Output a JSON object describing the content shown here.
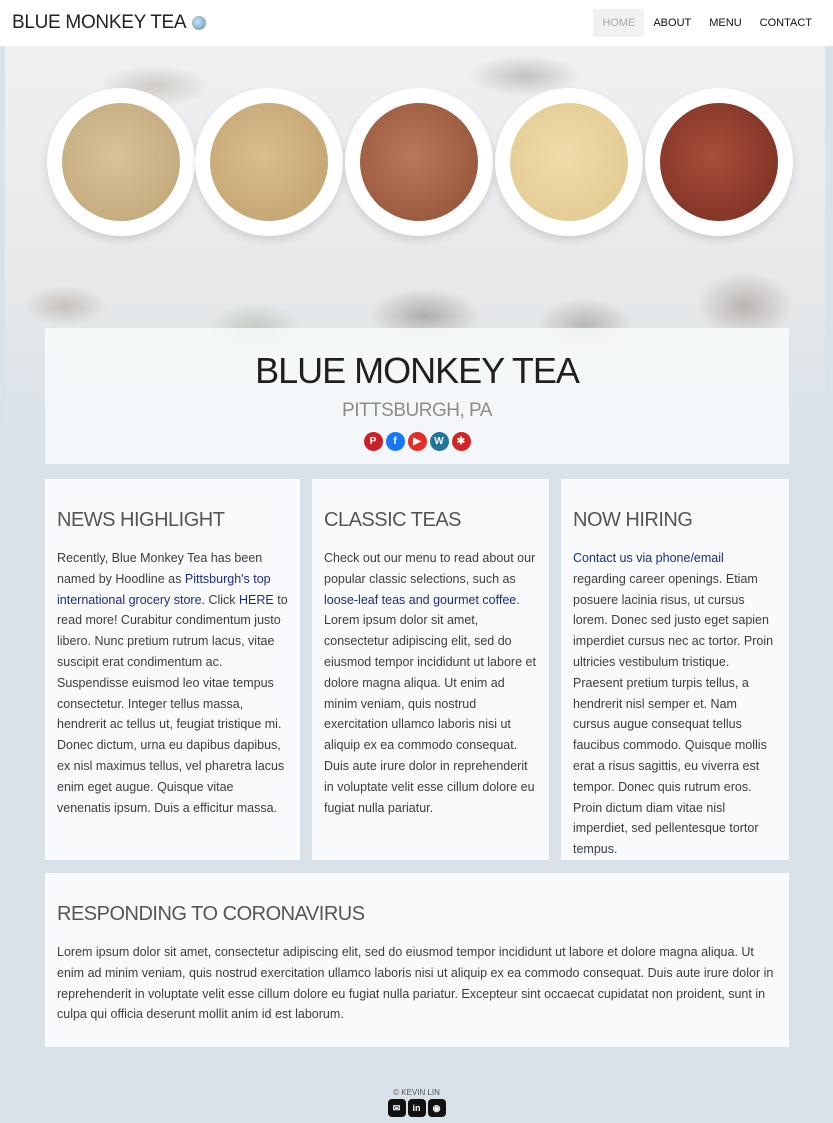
{
  "nav": {
    "brand": "BLUE MONKEY TEA",
    "brand_icon": "blue-teacup-logo-icon",
    "links": [
      {
        "label": "HOME",
        "active": true
      },
      {
        "label": "ABOUT",
        "active": false
      },
      {
        "label": "MENU",
        "active": false
      },
      {
        "label": "CONTACT",
        "active": false
      }
    ]
  },
  "hero": {
    "title": "BLUE MONKEY TEA",
    "subtitle": "PITTSBURGH, PA",
    "socials": [
      {
        "icon": "pinterest-icon",
        "color": "#cb2027",
        "glyph": "P"
      },
      {
        "icon": "facebook-icon",
        "color": "#1877f2",
        "glyph": "f"
      },
      {
        "icon": "youtube-icon",
        "color": "#e52d27",
        "glyph": "▶"
      },
      {
        "icon": "wordpress-icon",
        "color": "#21759b",
        "glyph": "W"
      },
      {
        "icon": "yelp-icon",
        "color": "#d32323",
        "glyph": "✱"
      }
    ]
  },
  "news": {
    "title": "NEWS HIGHLIGHT",
    "text_1": "Recently, Blue Monkey Tea has been named by Hoodline as ",
    "link_1": "Pittsburgh's top international grocery store.",
    "text_2": " Click ",
    "link_2": "HERE",
    "text_3": " to read more! Curabitur condimentum justo libero. Nunc pretium rutrum lacus, vitae suscipit erat condimentum ac. Suspendisse euismod leo vitae tempus consectetur. Integer tellus massa, hendrerit ac tellus ut, feugiat tristique mi. Donec dictum, urna eu dapibus dapibus, ex nisl maximus tellus, vel pharetra lacus enim eget augue. Quisque vitae venenatis ipsum. Duis a efficitur massa."
  },
  "classic": {
    "title": "CLASSIC TEAS",
    "text_1": "Check out our menu to read about our popular classic selections, such as ",
    "link_1": "loose-leaf teas and gourmet coffee.",
    "text_2": " Lorem ipsum dolor sit amet, consectetur adipiscing elit, sed do eiusmod tempor incididunt ut labore et dolore magna aliqua. Ut enim ad minim veniam, quis nostrud exercitation ullamco laboris nisi ut aliquip ex ea commodo consequat. Duis aute irure dolor in reprehenderit in voluptate velit esse cillum dolore eu fugiat nulla pariatur."
  },
  "hiring": {
    "title": "NOW HIRING",
    "link_1": "Contact us via phone/email",
    "text_1": " regarding career openings. Etiam posuere lacinia risus, ut cursus lorem. Donec sed justo eget sapien imperdiet cursus nec ac tortor. Proin ultricies vestibulum tristique. Praesent pretium turpis tellus, a hendrerit nisl semper et. Nam cursus augue consequat tellus faucibus commodo. Quisque mollis erat a risus sagittis, eu viverra est tempor. Donec quis rutrum eros. Proin dictum diam vitae nisl imperdiet, sed pellentesque tortor tempus."
  },
  "corona": {
    "title": "RESPONDING TO CORONAVIRUS",
    "text": "Lorem ipsum dolor sit amet, consectetur adipiscing elit, sed do eiusmod tempor incididunt ut labore et dolore magna aliqua. Ut enim ad minim veniam, quis nostrud exercitation ullamco laboris nisi ut aliquip ex ea commodo consequat. Duis aute irure dolor in reprehenderit in voluptate velit esse cillum dolore eu fugiat nulla pariatur. Excepteur sint occaecat cupidatat non proident, sunt in culpa qui officia deserunt mollit anim id est laborum."
  },
  "footer": {
    "copyright": "© KEVIN LIN",
    "icons": [
      {
        "icon": "email-icon",
        "glyph": "✉"
      },
      {
        "icon": "linkedin-icon",
        "glyph": "in"
      },
      {
        "icon": "github-icon",
        "glyph": "◉"
      }
    ]
  }
}
